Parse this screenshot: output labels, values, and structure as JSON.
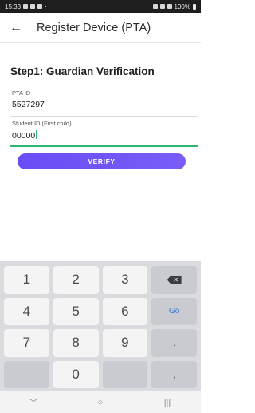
{
  "status_bar": {
    "time": "15:33",
    "battery_text": "100%"
  },
  "app_bar": {
    "title": "Register Device (PTA)"
  },
  "form": {
    "step_title": "Step1: Guardian Verification",
    "pta_id": {
      "label": "PTA ID",
      "value": "5527297"
    },
    "student_id": {
      "label": "Student ID (First child)",
      "value": "00000"
    },
    "verify_label": "VERIFY"
  },
  "keypad": {
    "keys": [
      "1",
      "2",
      "3",
      "4",
      "5",
      "6",
      "Go",
      "7",
      "8",
      "9",
      ".",
      "0",
      ","
    ]
  },
  "nav_bar": {
    "back_glyph": "﹀",
    "home_glyph": "○",
    "recents_glyph": "|||"
  },
  "colors": {
    "accent": "#6a4df5",
    "focus_underline": "#2bb673",
    "go_key": "#3a78d6"
  }
}
